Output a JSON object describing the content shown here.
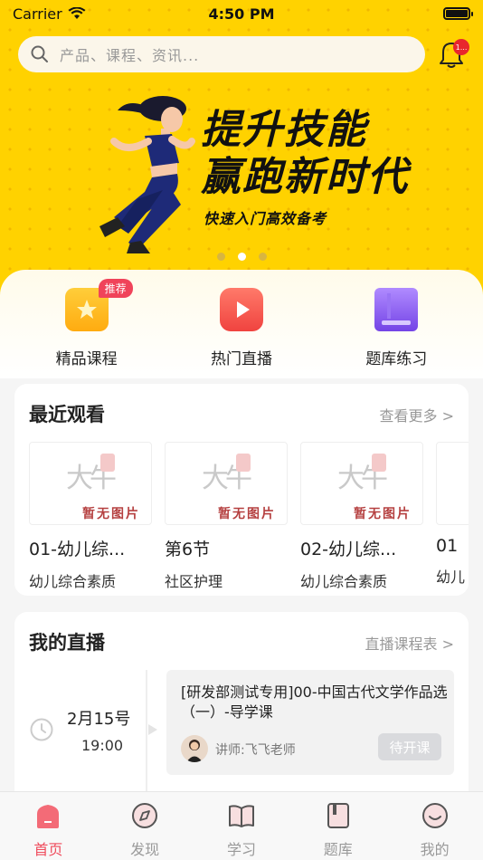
{
  "status_bar": {
    "carrier": "Carrier",
    "time": "4:50 PM"
  },
  "search": {
    "placeholder": "产品、课程、资讯..."
  },
  "notification": {
    "badge": "1..."
  },
  "banner": {
    "headline_line1": "提升技能",
    "headline_line2": "赢跑新时代",
    "subline": "快速入门高效备考",
    "page_count": 3,
    "active_page": 2
  },
  "quick_menu": [
    {
      "label": "精品课程",
      "tag": "推荐",
      "icon": "star-course-icon"
    },
    {
      "label": "热门直播",
      "tag": "",
      "icon": "play-live-icon"
    },
    {
      "label": "题库练习",
      "tag": "",
      "icon": "book-icon"
    }
  ],
  "recent": {
    "title": "最近观看",
    "more": "查看更多 >",
    "items": [
      {
        "title": "01-幼儿综...",
        "subtitle": "幼儿综合素质",
        "no_image": "暂无图片",
        "logo_text": "大牛"
      },
      {
        "title": "第6节",
        "subtitle": "社区护理",
        "no_image": "暂无图片",
        "logo_text": "大牛"
      },
      {
        "title": "02-幼儿综...",
        "subtitle": "幼儿综合素质",
        "no_image": "暂无图片",
        "logo_text": "大牛"
      },
      {
        "title": "01",
        "subtitle": "幼儿",
        "no_image": "",
        "logo_text": ""
      }
    ]
  },
  "live": {
    "title": "我的直播",
    "more": "直播课程表 >",
    "date": "2月15号",
    "time": "19:00",
    "course_title": "[研发部测试专用]00-中国古代文学作品选（一）-导学课",
    "lecturer": "讲师:飞飞老师",
    "button": "待开课"
  },
  "tabbar": [
    {
      "label": "首页",
      "icon": "home-icon",
      "active": true
    },
    {
      "label": "发现",
      "icon": "discover-icon",
      "active": false
    },
    {
      "label": "学习",
      "icon": "study-book-icon",
      "active": false
    },
    {
      "label": "题库",
      "icon": "question-bank-icon",
      "active": false
    },
    {
      "label": "我的",
      "icon": "profile-icon",
      "active": false
    }
  ],
  "colors": {
    "brand_yellow": "#ffd200",
    "accent_red": "#ef4b5c",
    "muted": "#999999"
  }
}
